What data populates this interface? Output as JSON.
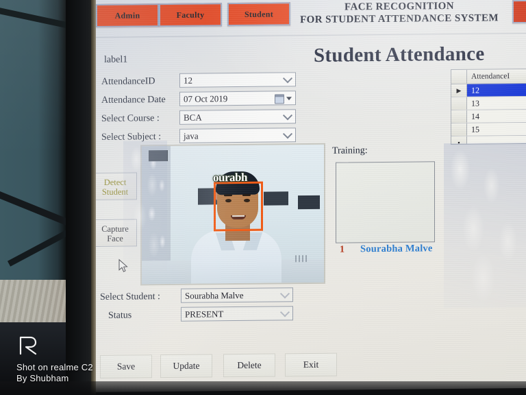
{
  "window": {
    "app_title_line1": "FACE RECOGNITION",
    "app_title_line2": "FOR STUDENT ATTENDANCE SYSTEM"
  },
  "navbar": {
    "admin_label": "Admin",
    "faculty_label": "Faculty",
    "student_label": "Student",
    "logout_label": "",
    "button_color": "#e8441c"
  },
  "page": {
    "heading": "Student Attendance",
    "label1": "label1"
  },
  "form": {
    "attendance_id": {
      "label": "AttendanceID",
      "value": "12"
    },
    "attendance_date": {
      "label": "Attendance Date",
      "value": "07 Oct 2019"
    },
    "course": {
      "label": "Select Course :",
      "value": "BCA"
    },
    "subject": {
      "label": "Select Subject :",
      "value": "java"
    },
    "student": {
      "label": "Select Student :",
      "value": "Sourabha Malve"
    },
    "status": {
      "label": "Status",
      "value": "PRESENT"
    }
  },
  "actions": {
    "detect_student": "Detect Student",
    "detect_student_line1": "Detect",
    "detect_student_line2": "Student",
    "capture_face_line1": "Capture",
    "capture_face_line2": "Face",
    "detect_color": "#8a8218"
  },
  "webcam": {
    "detection_label": "ourabh",
    "box_color": "#f35a13"
  },
  "training": {
    "label": "Training:",
    "index": "1",
    "name": "Sourabha Malve",
    "index_color": "#b5391d",
    "name_color": "#2f7fd1"
  },
  "grid": {
    "header": "AttendanceI",
    "rows": [
      {
        "indicator": "▶",
        "value": "12",
        "selected": true
      },
      {
        "indicator": "",
        "value": "13",
        "selected": false
      },
      {
        "indicator": "",
        "value": "14",
        "selected": false
      },
      {
        "indicator": "",
        "value": "15",
        "selected": false
      },
      {
        "indicator": "▪",
        "value": "",
        "selected": false
      }
    ],
    "selected_color": "#1535d8"
  },
  "footer": {
    "save": "Save",
    "update": "Update",
    "delete": "Delete",
    "exit": "Exit"
  },
  "watermark": {
    "logo": "ʀ",
    "line1": "Shot on realme C2",
    "line2": "By Shubham"
  }
}
